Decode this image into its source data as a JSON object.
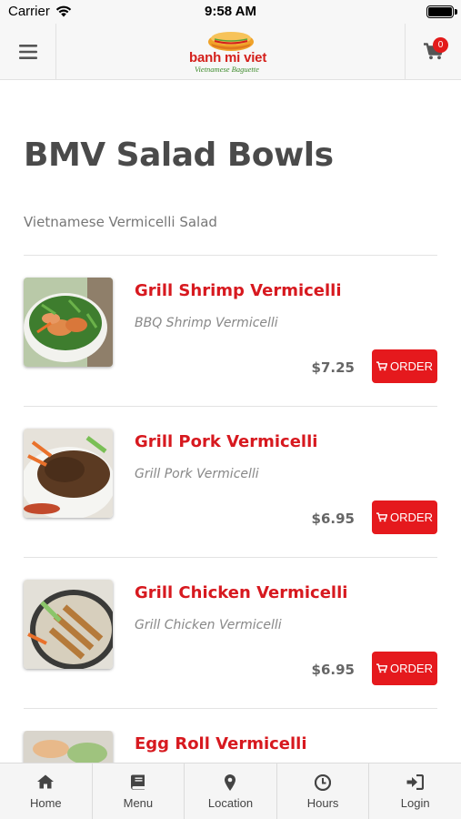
{
  "status_bar": {
    "carrier": "Carrier",
    "time": "9:58 AM",
    "battery_level": 1.0
  },
  "header": {
    "menu_icon": "hamburger-icon",
    "logo_name": "banh mi viet",
    "logo_tagline": "Vietnamese Baguette",
    "cart_icon": "cart-icon",
    "cart_count": "0"
  },
  "page": {
    "title": "BMV Salad Bowls",
    "subtitle": "Vietnamese Vermicelli Salad"
  },
  "items": [
    {
      "name": "Grill Shrimp Vermicelli",
      "description": "BBQ Shrimp Vermicelli",
      "price": "$7.25",
      "order_label": "ORDER"
    },
    {
      "name": "Grill Pork Vermicelli",
      "description": "Grill Pork Vermicelli",
      "price": "$6.95",
      "order_label": "ORDER"
    },
    {
      "name": "Grill Chicken Vermicelli",
      "description": "Grill Chicken Vermicelli",
      "price": "$6.95",
      "order_label": "ORDER"
    },
    {
      "name": "Egg Roll Vermicelli"
    }
  ],
  "tabs": [
    {
      "label": "Home",
      "icon": "home-icon"
    },
    {
      "label": "Menu",
      "icon": "book-icon"
    },
    {
      "label": "Location",
      "icon": "map-pin-icon"
    },
    {
      "label": "Hours",
      "icon": "clock-icon"
    },
    {
      "label": "Login",
      "icon": "login-icon"
    }
  ],
  "colors": {
    "accent": "#e5191d",
    "item_name": "#d7191f",
    "logo_green": "#3d8a2b"
  }
}
